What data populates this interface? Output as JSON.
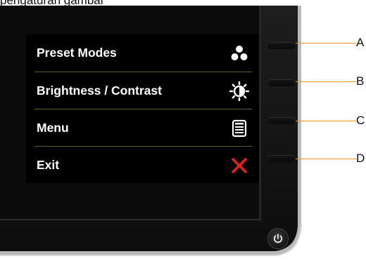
{
  "caption": "pengaturan gambar",
  "osd_menu": {
    "items": [
      {
        "label": "Preset Modes",
        "icon": "preset-modes-icon"
      },
      {
        "label": "Brightness / Contrast",
        "icon": "brightness-contrast-icon"
      },
      {
        "label": "Menu",
        "icon": "menu-icon"
      },
      {
        "label": "Exit",
        "icon": "exit-x-icon"
      }
    ],
    "separator_color": "#5c5f2c",
    "exit_icon_color": "#e02020"
  },
  "callouts": [
    "A",
    "B",
    "C",
    "D"
  ],
  "callout_line_color": "#f0941e",
  "power_button": {
    "icon": "power-icon"
  }
}
